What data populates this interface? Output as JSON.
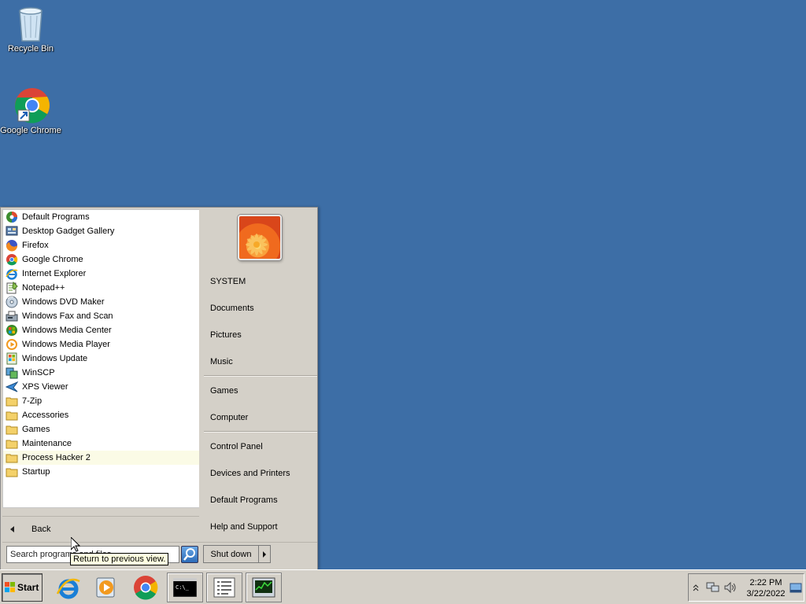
{
  "desktop": {
    "icons": [
      {
        "label": "Recycle Bin",
        "icon": "recycle-bin-icon"
      },
      {
        "label": "Google Chrome",
        "icon": "chrome-icon"
      }
    ]
  },
  "start_menu": {
    "programs": [
      {
        "label": "Default Programs",
        "icon": "default-programs-icon"
      },
      {
        "label": "Desktop Gadget Gallery",
        "icon": "gadget-gallery-icon"
      },
      {
        "label": "Firefox",
        "icon": "firefox-icon"
      },
      {
        "label": "Google Chrome",
        "icon": "chrome-icon"
      },
      {
        "label": "Internet Explorer",
        "icon": "internet-explorer-icon"
      },
      {
        "label": "Notepad++",
        "icon": "notepad-plus-plus-icon"
      },
      {
        "label": "Windows DVD Maker",
        "icon": "dvd-maker-icon"
      },
      {
        "label": "Windows Fax and Scan",
        "icon": "fax-scan-icon"
      },
      {
        "label": "Windows Media Center",
        "icon": "media-center-icon"
      },
      {
        "label": "Windows Media Player",
        "icon": "media-player-icon"
      },
      {
        "label": "Windows Update",
        "icon": "windows-update-icon"
      },
      {
        "label": "WinSCP",
        "icon": "winscp-icon"
      },
      {
        "label": "XPS Viewer",
        "icon": "xps-viewer-icon"
      },
      {
        "label": "7-Zip",
        "icon": "folder-icon"
      },
      {
        "label": "Accessories",
        "icon": "folder-icon"
      },
      {
        "label": "Games",
        "icon": "folder-icon"
      },
      {
        "label": "Maintenance",
        "icon": "folder-icon"
      },
      {
        "label": "Process Hacker 2",
        "icon": "folder-icon",
        "highlighted": true
      },
      {
        "label": "Startup",
        "icon": "folder-icon"
      }
    ],
    "back_label": "Back",
    "search_value": "Search programs and files",
    "search_placeholder": "Search programs and files",
    "shutdown_label": "Shut down",
    "right": {
      "user": "SYSTEM",
      "documents": "Documents",
      "pictures": "Pictures",
      "music": "Music",
      "games": "Games",
      "computer": "Computer",
      "control_panel": "Control Panel",
      "devices_printers": "Devices and Printers",
      "default_programs": "Default Programs",
      "help_support": "Help and Support"
    }
  },
  "tooltip": "Return to previous view.",
  "taskbar": {
    "start_label": "Start",
    "pinned": [
      "internet-explorer-icon",
      "media-player-icon",
      "chrome-icon",
      "command-prompt-icon",
      "notepad-icon",
      "task-manager-icon"
    ],
    "clock": {
      "time": "2:22 PM",
      "date": "3/22/2022"
    }
  }
}
